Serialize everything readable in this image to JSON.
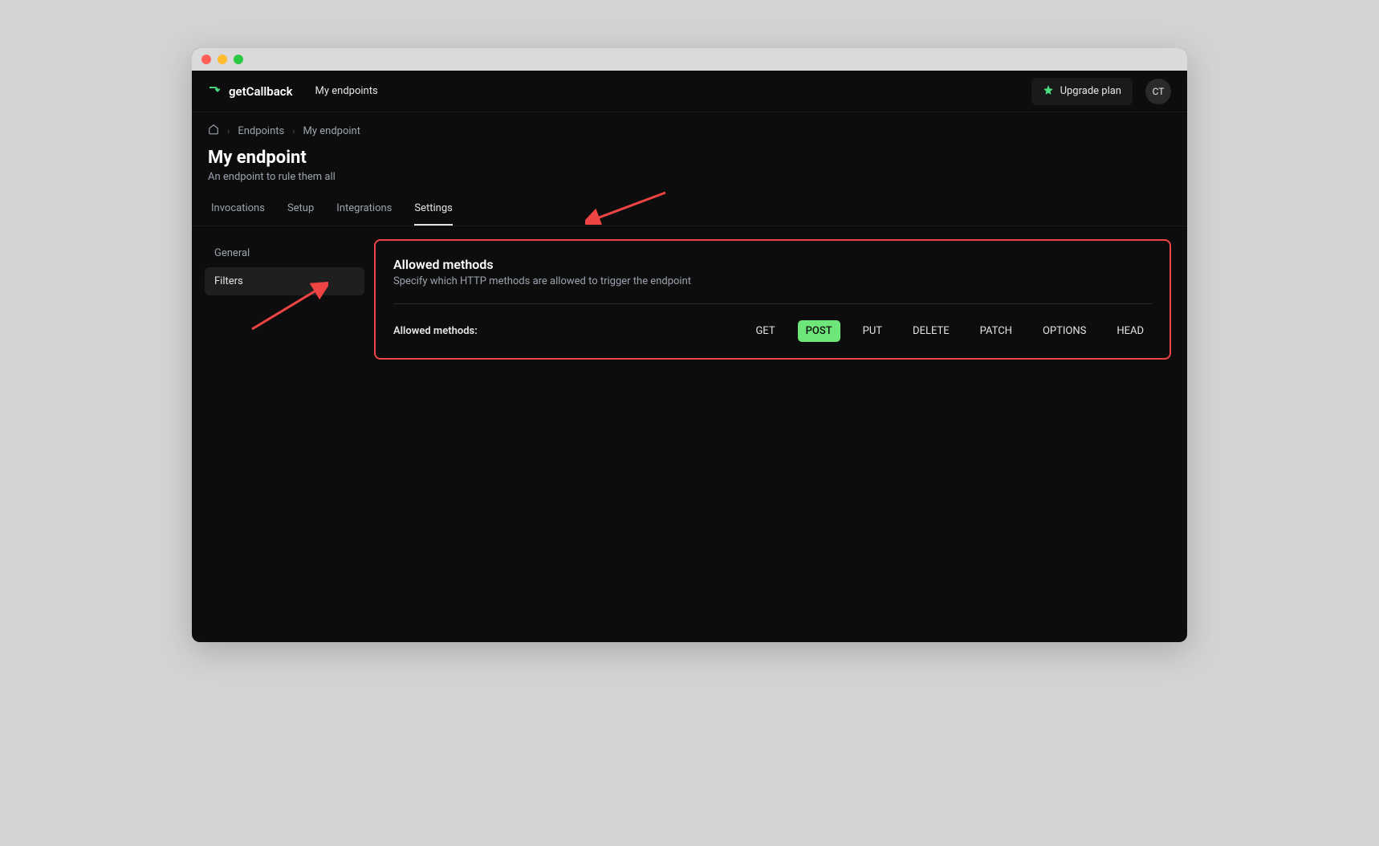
{
  "brand": {
    "name": "getCallback"
  },
  "topnav": {
    "link1": "My endpoints",
    "upgrade": "Upgrade plan",
    "avatar_initials": "CT"
  },
  "breadcrumb": {
    "item1": "Endpoints",
    "item2": "My endpoint"
  },
  "page": {
    "title": "My endpoint",
    "subtitle": "An endpoint to rule them all"
  },
  "tabs": {
    "t1": "Invocations",
    "t2": "Setup",
    "t3": "Integrations",
    "t4": "Settings"
  },
  "sidebar": {
    "item1": "General",
    "item2": "Filters"
  },
  "card": {
    "title": "Allowed methods",
    "desc": "Specify which HTTP methods are allowed to trigger the endpoint",
    "label": "Allowed methods:"
  },
  "methods": {
    "m1": "GET",
    "m2": "POST",
    "m3": "PUT",
    "m4": "DELETE",
    "m5": "PATCH",
    "m6": "OPTIONS",
    "m7": "HEAD"
  },
  "colors": {
    "accent": "#4ade80",
    "highlight_border": "#ef4444",
    "bg": "#0d0d0d"
  }
}
